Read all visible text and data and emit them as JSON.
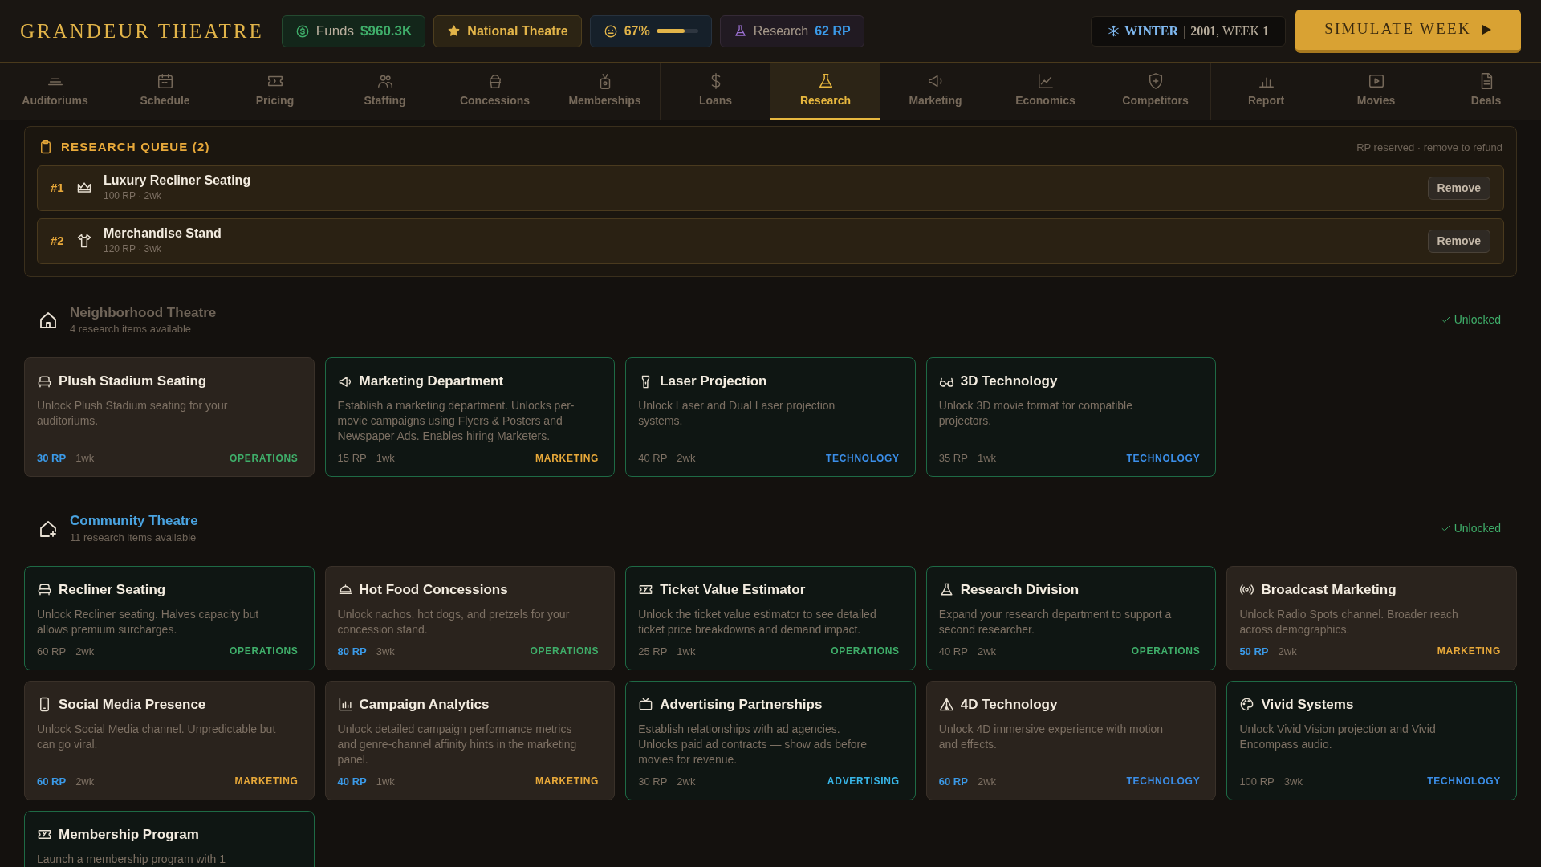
{
  "app_title": "GRANDEUR THEATRE",
  "stats": {
    "funds": {
      "label": "Funds",
      "value": "$960.3K"
    },
    "rank": {
      "label": "National Theatre"
    },
    "mood": {
      "value": "67%",
      "level": 0.67
    },
    "research": {
      "label": "Research",
      "value": "62 RP"
    }
  },
  "date": {
    "season": "WINTER",
    "separator": "|",
    "year_week": "**2001**, WEEK **1**"
  },
  "simulate_button": "SIMULATE WEEK",
  "nav_groups": [
    [
      {
        "label": "Auditoriums",
        "selected": false
      },
      {
        "label": "Schedule",
        "selected": false
      },
      {
        "label": "Pricing",
        "selected": false
      },
      {
        "label": "Staffing",
        "selected": false
      },
      {
        "label": "Concessions",
        "selected": false
      },
      {
        "label": "Memberships",
        "selected": false
      }
    ],
    [
      {
        "label": "Loans",
        "selected": false
      },
      {
        "label": "Research",
        "selected": true
      },
      {
        "label": "Marketing",
        "selected": false
      },
      {
        "label": "Economics",
        "selected": false
      },
      {
        "label": "Competitors",
        "selected": false
      }
    ],
    [
      {
        "label": "Report",
        "selected": false
      },
      {
        "label": "Movies",
        "selected": false
      },
      {
        "label": "Deals",
        "selected": false
      }
    ]
  ],
  "queue": {
    "title": "RESEARCH QUEUE (2)",
    "note": "RP reserved · remove to refund",
    "items": [
      {
        "rank": "#1",
        "name": "Luxury Recliner Seating",
        "meta": "100 RP · 2wk",
        "button": "Remove"
      },
      {
        "rank": "#2",
        "name": "Merchandise Stand",
        "meta": "120 RP · 3wk",
        "button": "Remove"
      }
    ]
  },
  "sections": [
    {
      "title": "Neighborhood Theatre",
      "subtitle": "4 research items available",
      "status": "Unlocked",
      "current": false,
      "cards": [
        {
          "title": "Plush Stadium Seating",
          "description": "Unlock Plush Stadium seating for your auditoriums.",
          "cost": "30 RP",
          "duration": "1wk",
          "category": "OPERATIONS",
          "color": "#3fae6a",
          "completed": false
        },
        {
          "title": "Marketing Department",
          "description": "Establish a marketing department. Unlocks per-movie campaigns using Flyers & Posters and Newspaper Ads. Enables hiring Marketers.",
          "cost": "15 RP",
          "duration": "1wk",
          "category": "MARKETING",
          "color": "#e8a93a",
          "completed": true
        },
        {
          "title": "Laser Projection",
          "description": "Unlock Laser and Dual Laser projection systems.",
          "cost": "40 RP",
          "duration": "2wk",
          "category": "TECHNOLOGY",
          "color": "#3b8ee8",
          "completed": true
        },
        {
          "title": "3D Technology",
          "description": "Unlock 3D movie format for compatible projectors.",
          "cost": "35 RP",
          "duration": "1wk",
          "category": "TECHNOLOGY",
          "color": "#3b8ee8",
          "completed": true
        }
      ]
    },
    {
      "title": "Community Theatre",
      "subtitle": "11 research items available",
      "status": "Unlocked",
      "current": true,
      "cards": [
        {
          "title": "Recliner Seating",
          "description": "Unlock Recliner seating. Halves capacity but allows premium surcharges.",
          "cost": "60 RP",
          "duration": "2wk",
          "category": "OPERATIONS",
          "color": "#3fae6a",
          "completed": true
        },
        {
          "title": "Hot Food Concessions",
          "description": "Unlock nachos, hot dogs, and pretzels for your concession stand.",
          "cost": "80 RP",
          "duration": "3wk",
          "category": "OPERATIONS",
          "color": "#3fae6a",
          "completed": false
        },
        {
          "title": "Ticket Value Estimator",
          "description": "Unlock the ticket value estimator to see detailed ticket price breakdowns and demand impact.",
          "cost": "25 RP",
          "duration": "1wk",
          "category": "OPERATIONS",
          "color": "#3fae6a",
          "completed": true
        },
        {
          "title": "Research Division",
          "description": "Expand your research department to support a second researcher.",
          "cost": "40 RP",
          "duration": "2wk",
          "category": "OPERATIONS",
          "color": "#3fae6a",
          "completed": true
        },
        {
          "title": "Broadcast Marketing",
          "description": "Unlock Radio Spots channel. Broader reach across demographics.",
          "cost": "50 RP",
          "duration": "2wk",
          "category": "MARKETING",
          "color": "#e8a93a",
          "completed": false
        },
        {
          "title": "Social Media Presence",
          "description": "Unlock Social Media channel. Unpredictable but can go viral.",
          "cost": "60 RP",
          "duration": "2wk",
          "category": "MARKETING",
          "color": "#e8a93a",
          "completed": false
        },
        {
          "title": "Campaign Analytics",
          "description": "Unlock detailed campaign performance metrics and genre-channel affinity hints in the marketing panel.",
          "cost": "40 RP",
          "duration": "1wk",
          "category": "MARKETING",
          "color": "#e8a93a",
          "completed": false
        },
        {
          "title": "Advertising Partnerships",
          "description": "Establish relationships with ad agencies. Unlocks paid ad contracts — show ads before movies for revenue.",
          "cost": "30 RP",
          "duration": "2wk",
          "category": "ADVERTISING",
          "color": "#38b6e8",
          "completed": true
        },
        {
          "title": "4D Technology",
          "description": "Unlock 4D immersive experience with motion and effects.",
          "cost": "60 RP",
          "duration": "2wk",
          "category": "TECHNOLOGY",
          "color": "#3b8ee8",
          "completed": false
        },
        {
          "title": "Vivid Systems",
          "description": "Unlock Vivid Vision projection and Vivid Encompass audio.",
          "cost": "100 RP",
          "duration": "3wk",
          "category": "TECHNOLOGY",
          "color": "#3b8ee8",
          "completed": true
        },
        {
          "title": "Membership Program",
          "description": "Launch a membership program with 1",
          "completed": true
        }
      ]
    }
  ]
}
